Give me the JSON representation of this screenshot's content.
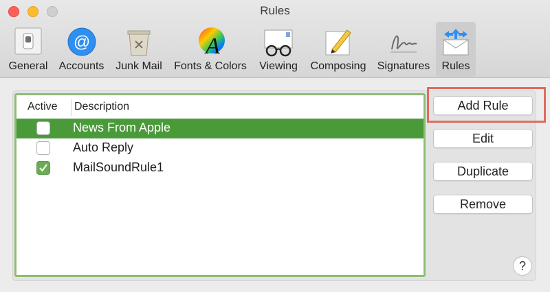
{
  "window": {
    "title": "Rules"
  },
  "toolbar": {
    "items": [
      {
        "label": "General",
        "icon": "switch-icon"
      },
      {
        "label": "Accounts",
        "icon": "at-sign-icon"
      },
      {
        "label": "Junk Mail",
        "icon": "trash-bin-icon"
      },
      {
        "label": "Fonts & Colors",
        "icon": "font-color-wheel-icon"
      },
      {
        "label": "Viewing",
        "icon": "glasses-envelope-icon"
      },
      {
        "label": "Composing",
        "icon": "pencil-paper-icon"
      },
      {
        "label": "Signatures",
        "icon": "signature-icon"
      },
      {
        "label": "Rules",
        "icon": "envelope-arrows-icon",
        "selected": true
      }
    ]
  },
  "rules_table": {
    "columns": {
      "active": "Active",
      "description": "Description"
    },
    "rows": [
      {
        "description": "News From Apple",
        "active": false,
        "selected": true
      },
      {
        "description": "Auto Reply",
        "active": false,
        "selected": false
      },
      {
        "description": "MailSoundRule1",
        "active": true,
        "selected": false
      }
    ]
  },
  "buttons": {
    "add_rule": "Add Rule",
    "edit": "Edit",
    "duplicate": "Duplicate",
    "remove": "Remove",
    "help": "?"
  },
  "colors": {
    "selection": "#4a9a3a",
    "list_border": "#8cbd72",
    "highlight_box": "#e06c5a"
  }
}
